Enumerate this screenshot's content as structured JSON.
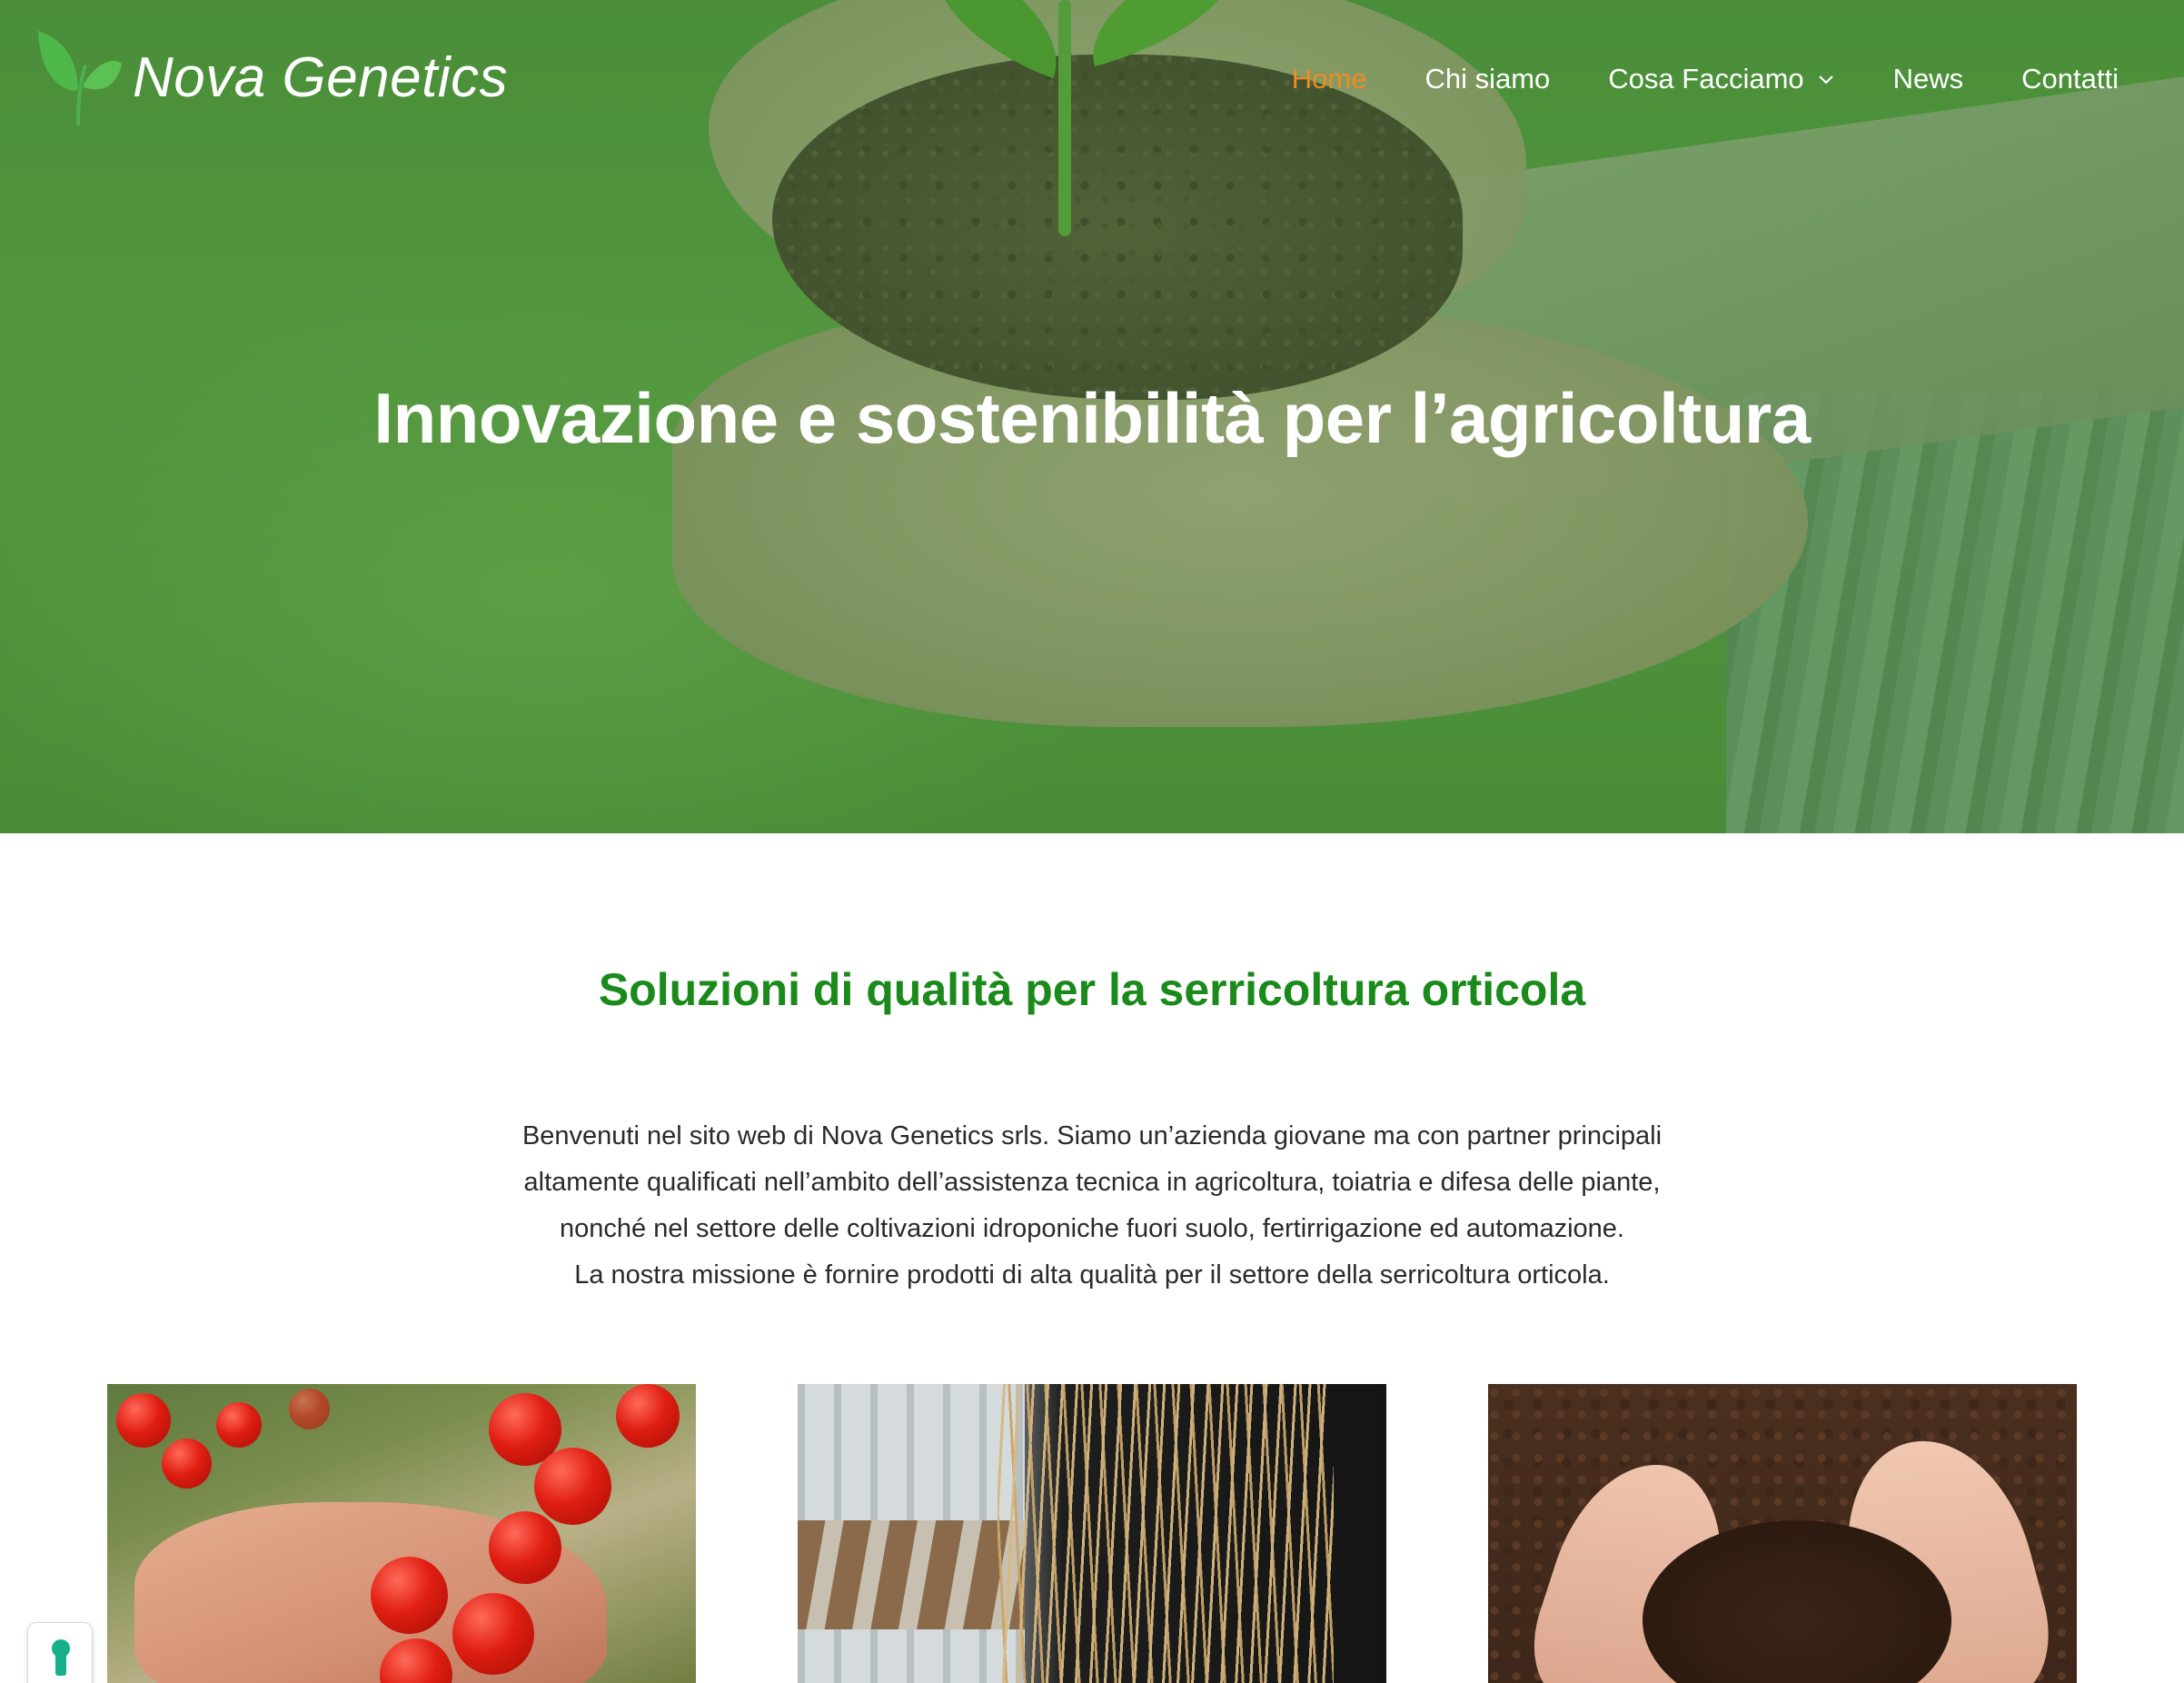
{
  "brand": {
    "name": "Nova Genetics",
    "logo_icon": "sprout-icon",
    "accent_color": "#1a8a1a",
    "nav_active_color": "#f08a24"
  },
  "nav": {
    "items": [
      {
        "label": "Home",
        "active": true
      },
      {
        "label": "Chi siamo",
        "active": false
      },
      {
        "label": "Cosa Facciamo",
        "active": false,
        "has_dropdown": true
      },
      {
        "label": "News",
        "active": false
      },
      {
        "label": "Contatti",
        "active": false
      }
    ]
  },
  "hero": {
    "title": "Innovazione e sostenibilità per l’agricoltura"
  },
  "main": {
    "section_title": "Soluzioni di qualità per la serricoltura orticola",
    "intro_lines": [
      "Benvenuti nel sito web di Nova Genetics srls. Siamo un’azienda giovane ma con partner principali",
      "altamente qualificati nell’ambito dell’assistenza tecnica in agricoltura, toiatria e difesa delle piante,",
      "nonché nel settore delle coltivazioni idroponiche fuori suolo, fertirrigazione ed automazione.",
      "La nostra missione è fornire prodotti di alta qualità per il settore della serricoltura orticola."
    ]
  },
  "privacy_badge": {
    "icon": "keyhole-icon"
  }
}
